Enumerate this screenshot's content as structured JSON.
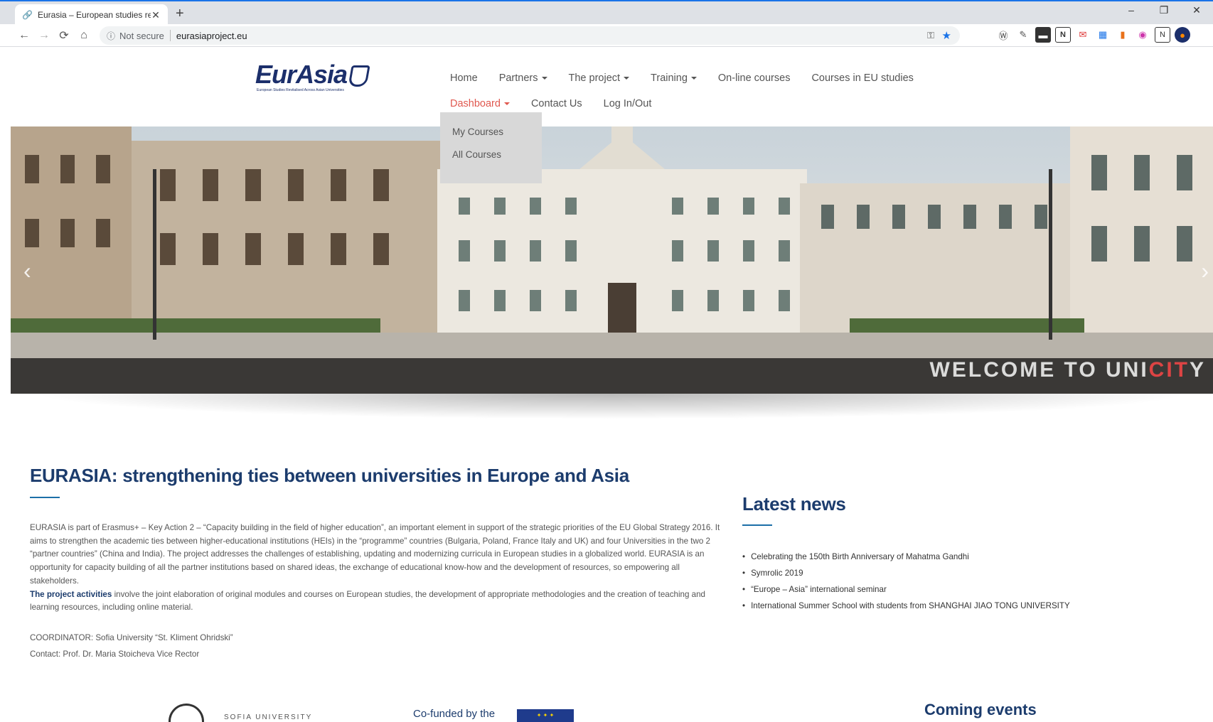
{
  "browser": {
    "tab_title": "Eurasia – European studies revita",
    "tab_close": "✕",
    "new_tab": "+",
    "window_controls": [
      "–",
      "❐",
      "✕"
    ],
    "not_secure": "Not secure",
    "url": "eurasiaproject.eu"
  },
  "site": {
    "logo_text": "EurAsia",
    "logo_tagline": "European Studies Revitalised Across Asian Universities",
    "menu_row1": [
      "Home",
      "Partners",
      "The project",
      "Training",
      "On-line courses",
      "Courses in EU studies"
    ],
    "menu_row2": [
      "Dashboard",
      "Contact Us",
      "Log In/Out"
    ],
    "dropdown": [
      "My Courses",
      "All Courses"
    ],
    "hero_caption_pre": "WELCOME TO UNI",
    "hero_caption_red": "CIT",
    "hero_caption_post": "Y",
    "main_title": "EURASIA: strengthening ties between universities in Europe and Asia",
    "paragraph1": "EURASIA is part of Erasmus+ – Key Action 2 – “Capacity building in the field of higher education”, an important element in support of the strategic priorities of the EU Global Strategy 2016. It aims to strengthen the academic ties between higher-educational institutions (HEIs) in the “programme” countries (Bulgaria, Poland, France Italy and UK) and four Universities in the two 2 “partner countries” (China and India). The project addresses the challenges of establishing, updating and modernizing curricula in European studies in a globalized world. EURASIA is an opportunity for capacity building of all the partner institutions based on shared ideas, the exchange of educational know-how and the development of resources, so empowering all stakeholders.",
    "paragraph2_strong": "The project activities",
    "paragraph2_rest": " involve the joint elaboration of original modules and courses on European studies, the development of appropriate methodologies and the creation of teaching and learning resources, including online material.",
    "coordinator": "COORDINATOR: Sofia University “St. Kliment Ohridski”",
    "contact": "Contact: Prof. Dr. Maria Stoicheva Vice Rector",
    "news_title": "Latest news",
    "news": [
      "Celebrating the 150th Birth Anniversary of Mahatma Gandhi",
      "Symrolic 2019",
      "“Europe – Asia” international seminar",
      "International Summer School with students from SHANGHAI JIAO TONG UNIVERSITY"
    ],
    "coming_events": "Coming events",
    "sofia_label": "SOFIA UNIVERSITY",
    "cofunded": "Co-funded by the",
    "eu_flag_stars": "✦ ✦ ✦"
  },
  "colors": {
    "accent_active": "#e0584f",
    "heading_blue": "#1c3c6d"
  }
}
